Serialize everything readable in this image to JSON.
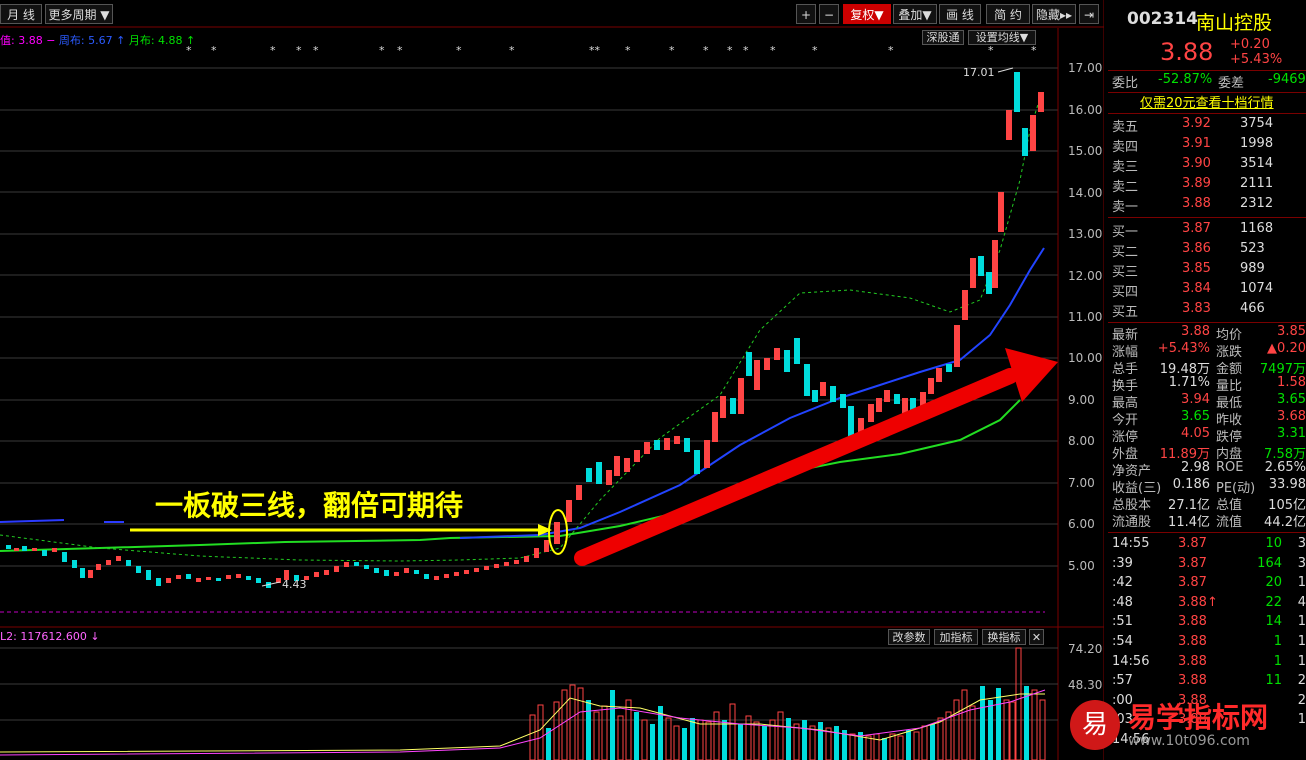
{
  "toolbar": {
    "period": "月 线",
    "more_periods": "更多周期",
    "right_btns": [
      "+",
      "−",
      "复权",
      "叠加",
      "画 线",
      "简 约",
      "隐藏"
    ]
  },
  "ma_legend": {
    "ma1": "3.88",
    "ma2_label": "周布: 5.67",
    "ma3_label": "月布: 4.88"
  },
  "sub_buttons": {
    "shenzhen": "深股通",
    "set_ma": "设置均线"
  },
  "annotation": "一板破三线，翻倍可期待",
  "high_label": "17.01",
  "low_label": "4.43",
  "y_axis": [
    "17.00",
    "16.00",
    "15.00",
    "14.00",
    "13.00",
    "12.00",
    "11.00",
    "10.00",
    "9.00",
    "8.00",
    "7.00",
    "6.00",
    "5.00"
  ],
  "volume": {
    "label": "L2: 117612.600",
    "buttons": [
      "改参数",
      "加指标",
      "换指标"
    ],
    "axis": [
      "74.20",
      "48.30"
    ]
  },
  "stock": {
    "code": "002314",
    "name": "南山控股",
    "price": "3.88",
    "change": "+0.20",
    "pct": "+5.43%"
  },
  "weibi": {
    "label1": "委比",
    "val1": "-52.87%",
    "label2": "委差",
    "val2": "-9469"
  },
  "promo": "仅需20元查看十档行情",
  "asks": [
    [
      "卖五",
      "3.92",
      "3754"
    ],
    [
      "卖四",
      "3.91",
      "1998"
    ],
    [
      "卖三",
      "3.90",
      "3514"
    ],
    [
      "卖二",
      "3.89",
      "2111"
    ],
    [
      "卖一",
      "3.88",
      "2312"
    ]
  ],
  "bids": [
    [
      "买一",
      "3.87",
      "1168"
    ],
    [
      "买二",
      "3.86",
      "523"
    ],
    [
      "买三",
      "3.85",
      "989"
    ],
    [
      "买四",
      "3.84",
      "1074"
    ],
    [
      "买五",
      "3.83",
      "466"
    ]
  ],
  "stats": [
    [
      "最新",
      "3.88",
      "均价",
      "3.85"
    ],
    [
      "涨幅",
      "+5.43%",
      "涨跌",
      "▲0.20"
    ],
    [
      "总手",
      "19.48万",
      "金额",
      "7497万"
    ],
    [
      "换手",
      "1.71%",
      "量比",
      "1.58"
    ],
    [
      "最高",
      "3.94",
      "最低",
      "3.65"
    ],
    [
      "今开",
      "3.65",
      "昨收",
      "3.68"
    ],
    [
      "涨停",
      "4.05",
      "跌停",
      "3.31"
    ],
    [
      "外盘",
      "11.89万",
      "内盘",
      "7.58万"
    ],
    [
      "净资产",
      "2.98",
      "ROE",
      "2.65%"
    ],
    [
      "收益(三)",
      "0.186",
      "PE(动)",
      "33.98"
    ],
    [
      "总股本",
      "27.1亿",
      "总值",
      "105亿"
    ],
    [
      "流通股",
      "11.4亿",
      "流值",
      "44.2亿"
    ]
  ],
  "ticks": [
    [
      "14:55",
      "3.87",
      "10",
      "3"
    ],
    [
      ":39",
      "3.87",
      "164",
      "3"
    ],
    [
      ":42",
      "3.87",
      "20",
      "1"
    ],
    [
      ":48",
      "3.88↑",
      "22",
      "4"
    ],
    [
      ":51",
      "3.88",
      "14",
      "1"
    ],
    [
      ":54",
      "3.88",
      "1",
      "1"
    ],
    [
      "14:56",
      "3.88",
      "1",
      "1"
    ],
    [
      ":57",
      "3.88",
      "11",
      "2"
    ],
    [
      ":00",
      "3.88",
      "",
      "2"
    ],
    [
      ":03",
      "3.88",
      "",
      "1"
    ],
    [
      "14:56",
      "",
      "",
      ""
    ]
  ],
  "watermark": {
    "brand": "易学指标网",
    "icon": "易",
    "url": "www.10t096.com"
  }
}
